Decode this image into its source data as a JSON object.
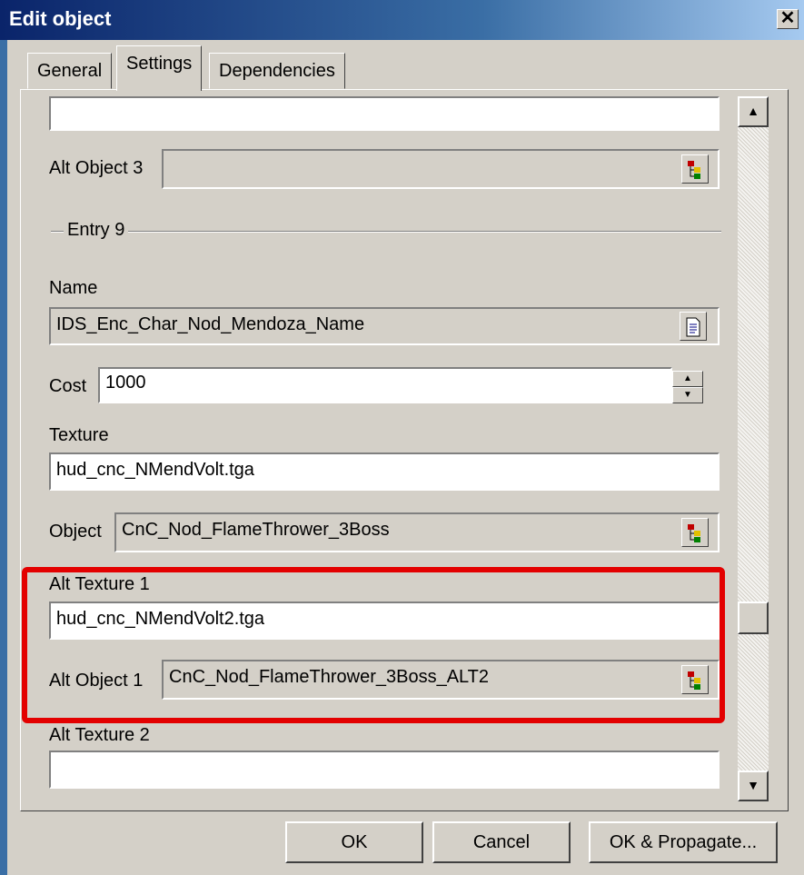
{
  "window": {
    "title": "Edit object",
    "close_label": "✕"
  },
  "tabs": [
    {
      "label": "General",
      "active": false
    },
    {
      "label": "Settings",
      "active": true
    },
    {
      "label": "Dependencies",
      "active": false
    }
  ],
  "fields": {
    "top_field_value": "",
    "alt_object_3": {
      "label": "Alt Object 3",
      "value": ""
    },
    "group_label": "Entry 9",
    "name": {
      "label": "Name",
      "value": "IDS_Enc_Char_Nod_Mendoza_Name"
    },
    "cost": {
      "label": "Cost",
      "value": "1000"
    },
    "texture": {
      "label": "Texture",
      "value": "hud_cnc_NMendVolt.tga"
    },
    "object": {
      "label": "Object",
      "value": "CnC_Nod_FlameThrower_3Boss"
    },
    "alt_texture_1": {
      "label": "Alt Texture 1",
      "value": "hud_cnc_NMendVolt2.tga"
    },
    "alt_object_1": {
      "label": "Alt Object 1",
      "value": "CnC_Nod_FlameThrower_3Boss_ALT2"
    },
    "alt_texture_2": {
      "label": "Alt Texture 2",
      "value": ""
    }
  },
  "buttons": {
    "ok": "OK",
    "cancel": "Cancel",
    "ok_propagate": "OK & Propagate..."
  },
  "colors": {
    "highlight": "#e30000",
    "dialog_bg": "#d4d0c8",
    "title_bar": "#0a246a"
  },
  "icons": [
    "tree-picker-icon",
    "document-icon",
    "scroll-up-icon",
    "scroll-down-icon",
    "close-icon"
  ]
}
